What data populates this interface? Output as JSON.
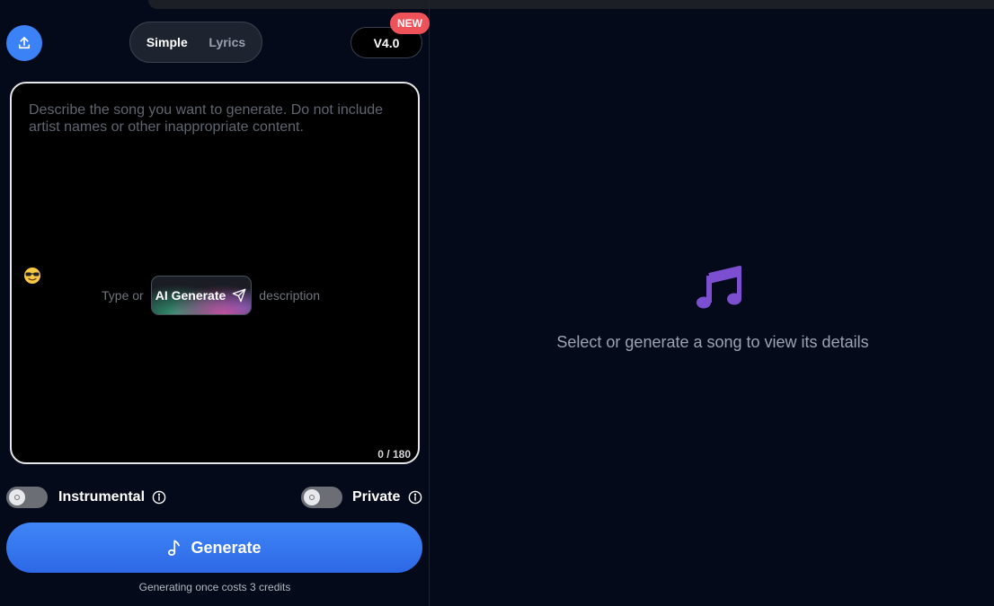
{
  "mode_toggle": {
    "simple_label": "Simple",
    "lyrics_label": "Lyrics",
    "active": "Simple"
  },
  "version": {
    "label": "V4.0",
    "badge": "NEW"
  },
  "prompt": {
    "placeholder": "Describe the song you want to generate. Do not include artist names or other inappropriate content.",
    "prefix_text": "Type or",
    "ai_button_label": "AI Generate",
    "suffix_text": "description",
    "counter": "0 / 180"
  },
  "options": {
    "instrumental_label": "Instrumental",
    "instrumental_on": false,
    "private_label": "Private",
    "private_on": false
  },
  "generate": {
    "label": "Generate",
    "cost_text": "Generating once costs 3 credits"
  },
  "detail_panel": {
    "message": "Select or generate a song to view its details"
  },
  "icons": {
    "upload": "upload-icon",
    "emoji": "sunglasses-emoji-icon",
    "send": "send-icon",
    "info": "info-icon",
    "music_note": "music-note-icon",
    "music_notes": "music-notes-icon"
  },
  "colors": {
    "accent": "#3b82f6",
    "badge": "#f0525a",
    "music_icon": "#7c4fd0",
    "background": "#050a1a"
  }
}
